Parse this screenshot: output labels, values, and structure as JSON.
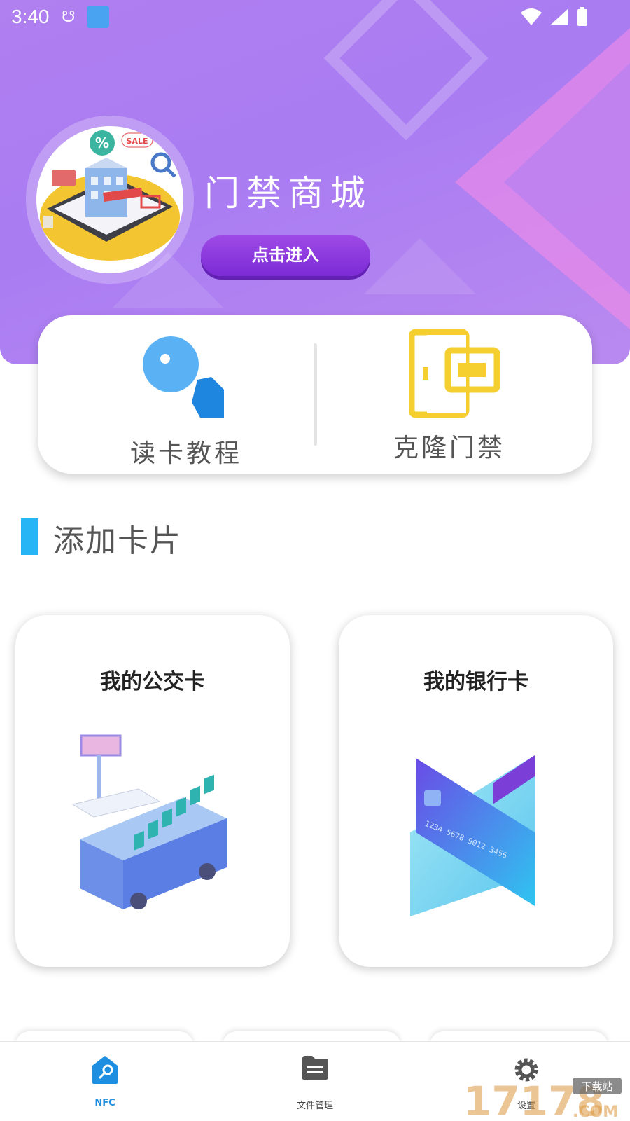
{
  "status_bar": {
    "time": "3:40"
  },
  "banner": {
    "mall_title": "门禁商城",
    "enter_button": "点击进入",
    "avatar_sale_text": "SALE",
    "avatar_percent_text": "%"
  },
  "quick_actions": [
    {
      "label": "读卡教程",
      "icon": "key-icon"
    },
    {
      "label": "克隆门禁",
      "icon": "door-card-icon"
    }
  ],
  "section": {
    "title": "添加卡片"
  },
  "cards": [
    {
      "title": "我的公交卡",
      "icon": "bus-icon"
    },
    {
      "title": "我的银行卡",
      "icon": "bank-card-icon"
    }
  ],
  "bank_card_number": "1234 5678 9012 3456",
  "bottom_nav": [
    {
      "label": "NFC",
      "icon": "nfc-key-icon",
      "active": true
    },
    {
      "label": "文件管理",
      "icon": "folder-icon",
      "active": false
    },
    {
      "label": "设置",
      "icon": "gear-icon",
      "active": false
    }
  ],
  "watermark": {
    "number": "17178",
    "suffix": ".COM",
    "tag": "下载站"
  },
  "colors": {
    "banner": "#ad7ef1",
    "accent_blue": "#27b5f5",
    "button_purple": "#8a35dd",
    "nav_active": "#1e8fe0",
    "door_yellow": "#f5cf2f"
  }
}
